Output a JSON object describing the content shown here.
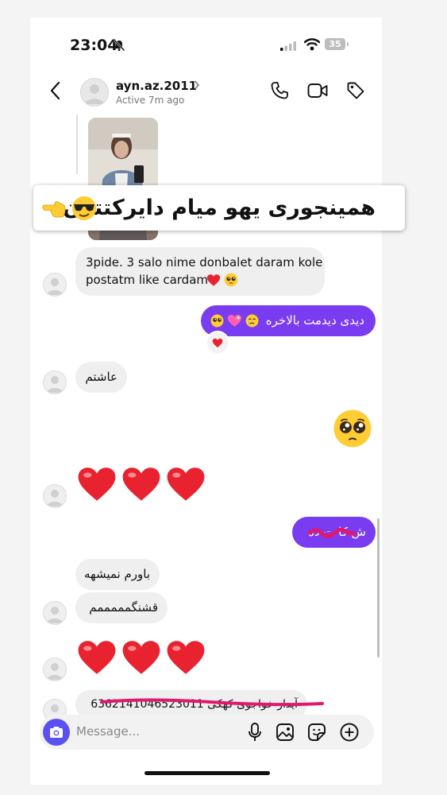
{
  "status_bar": {
    "time": "23:04",
    "battery": "35"
  },
  "header": {
    "username": "ayn.az.2011",
    "active_status": "Active 7m ago"
  },
  "overlay_caption": "همینجوری یهو میام دایرکتتون",
  "messages": {
    "m1_line1": "3pide. 3 salo nime donbalet daram kole",
    "m1_line2": "postatm like cardam",
    "m2_text": "دیدی دیدمت بالاخره",
    "m3_text": "عاشتم",
    "m5_text": "ش کا ت ده",
    "m6_text": "باورم نمیشهه",
    "m7_text": "قشنگمممممم",
    "m9_text": "آیدار خواجوی کهکی 6362141046523011"
  },
  "input": {
    "placeholder": "Message..."
  },
  "colors": {
    "accent_purple": "#7a3cf0",
    "camera_blue": "#5b51f2",
    "heart_red": "#e8232f",
    "scribble_pink": "#e0186e"
  }
}
